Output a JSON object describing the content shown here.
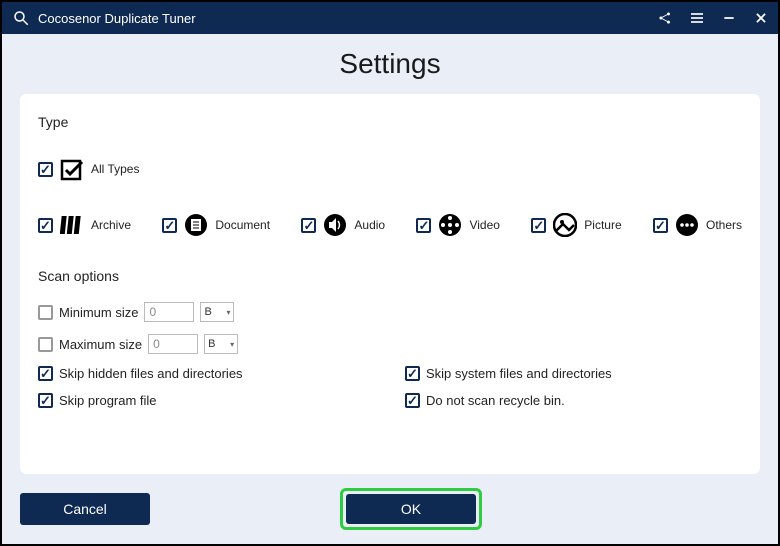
{
  "app": {
    "title": "Cocosenor Duplicate Tuner"
  },
  "page": {
    "heading": "Settings"
  },
  "type_section": {
    "label": "Type",
    "all": {
      "label": "All Types",
      "checked": true
    },
    "items": [
      {
        "key": "archive",
        "label": "Archive",
        "checked": true
      },
      {
        "key": "document",
        "label": "Document",
        "checked": true
      },
      {
        "key": "audio",
        "label": "Audio",
        "checked": true
      },
      {
        "key": "video",
        "label": "Video",
        "checked": true
      },
      {
        "key": "picture",
        "label": "Picture",
        "checked": true
      },
      {
        "key": "others",
        "label": "Others",
        "checked": true
      }
    ]
  },
  "scan_section": {
    "label": "Scan options",
    "min_size": {
      "label": "Minimum size",
      "value": "0",
      "unit": "B",
      "checked": false
    },
    "max_size": {
      "label": "Maximum size",
      "value": "0",
      "unit": "B",
      "checked": false
    },
    "skip_hidden": {
      "label": "Skip hidden files and directories",
      "checked": true
    },
    "skip_system": {
      "label": "Skip system files and directories",
      "checked": true
    },
    "skip_program": {
      "label": "Skip program file",
      "checked": true
    },
    "no_recycle": {
      "label": "Do not scan recycle bin.",
      "checked": true
    }
  },
  "buttons": {
    "cancel": "Cancel",
    "ok": "OK"
  }
}
